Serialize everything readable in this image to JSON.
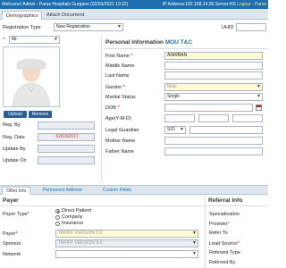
{
  "topbar": {
    "left_text": "Welcome! Admin - Paras Hospitals Gurgaon (02/03/2021 19:22)",
    "right_ip": "IP Address:192.168.14.06",
    "right_server": "Server:HS",
    "right_extra": "Logout - Paras"
  },
  "tabs": [
    "Demographics",
    "Attach Document"
  ],
  "registration": {
    "type_label": "Registration Type",
    "type_value": "New Registration",
    "uhid_label": "UHID"
  },
  "title_prefix": {
    "value": "Mr."
  },
  "photo_buttons": {
    "upload": "Upload",
    "remove": "Remove"
  },
  "left_meta": {
    "reg_by_label": "Reg. By",
    "reg_date_label": "Reg. Date",
    "reg_date_value": "02/03/2021",
    "update_by_label": "Update By",
    "update_on_label": "Update On"
  },
  "personal": {
    "section_title": "Personal Information",
    "section_link": "MOU T&C",
    "first_name_label": "First Name",
    "first_name_value": "ANIRBAN",
    "middle_name_label": "Middle Name",
    "last_name_label": "Last Name",
    "gender_label": "Gender",
    "gender_value": "Male",
    "marital_label": "Marital Status",
    "marital_value": "Single",
    "dob_label": "DOB",
    "age_label": "Age(Y-M-D)",
    "legal_guardian_label": "Legal Guardian",
    "legal_guardian_value": "S/O",
    "mother_name_label": "Mother Name",
    "father_name_label": "Father Name"
  },
  "bottom_tabs": [
    "Other Info",
    "Permanent Address",
    "Custom Fields"
  ],
  "payer": {
    "section_title": "Payer",
    "payer_type_label": "Payer Type",
    "options": [
      "Direct Patient",
      "Company",
      "Insurance"
    ],
    "payer_label": "Payer",
    "payer_value": "TARIFF VERSION 9.0",
    "sponsor_label": "Sponsor",
    "sponsor_value": "TARIFF VERSION 9.0",
    "network_label": "Network"
  },
  "referral": {
    "section_title": "Referral Info",
    "specialisation_label": "Specialisation",
    "provider_label": "Provider",
    "refer_to_label": "Refer To",
    "lead_source_label": "Lead Source",
    "referred_type_label": "Referred Type",
    "referred_by_label": "Referred By"
  },
  "colors": {
    "topbar": "#1f6fb0",
    "accent": "#2a5f95",
    "required": "#d10000",
    "highlight_field": "#fffbd3"
  }
}
